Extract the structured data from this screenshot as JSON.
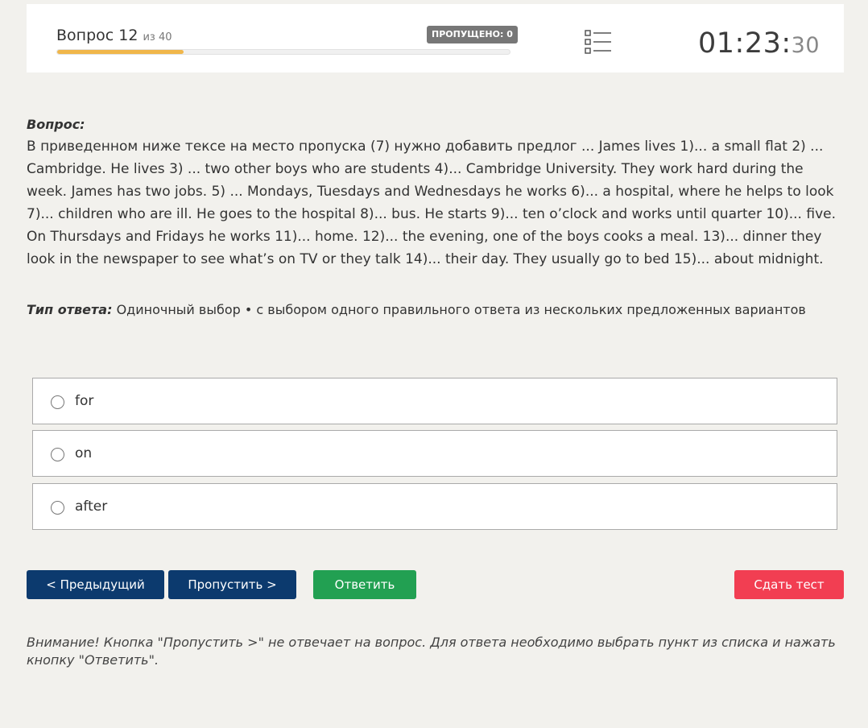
{
  "header": {
    "question_title": "Вопрос 12",
    "question_of": "из 40",
    "progress_fraction": 0.28,
    "skipped_badge": "ПРОПУЩЕНО: 0",
    "timer_main": "01:23:",
    "timer_seconds": "30",
    "progress_color": "#f0b64a"
  },
  "question": {
    "label": "Вопрос:",
    "text": "В приведенном ниже тексе на место пропуска (7) нужно добавить предлог ... James lives 1)... a small flat 2) ... Cambridge. He lives 3) ... two other boys who are students 4)... Cambridge University. They work hard during the week. James has two jobs. 5) ... Mondays, Tuesdays and Wednesdays he works 6)... a hospital, where he helps to look 7)... children who are ill. He goes to the hospital 8)... bus. He starts 9)... ten o’clock and works until quarter 10)... five. On Thursdays and Fridays he works 11)... home. 12)... the evening, one of the boys cooks a meal. 13)... dinner they look in the newspaper to see what’s on TV or they talk 14)... their day. They usually go to bed 15)... about midnight."
  },
  "answer_type": {
    "label": "Тип ответа:",
    "value": "Одиночный выбор • с выбором одного правильного ответа из нескольких предложенных вариантов"
  },
  "options": [
    {
      "label": "for"
    },
    {
      "label": "on"
    },
    {
      "label": "after"
    }
  ],
  "buttons": {
    "prev": "< Предыдущий",
    "skip": "Пропустить >",
    "answer": "Ответить",
    "submit": "Сдать тест"
  },
  "note": "Внимание! Кнопка \"Пропустить >\" не отвечает на вопрос. Для ответа необходимо выбрать пункт из списка и нажать кнопку \"Ответить\".",
  "icons": {
    "list": "list-icon",
    "radio": "radio-icon"
  }
}
